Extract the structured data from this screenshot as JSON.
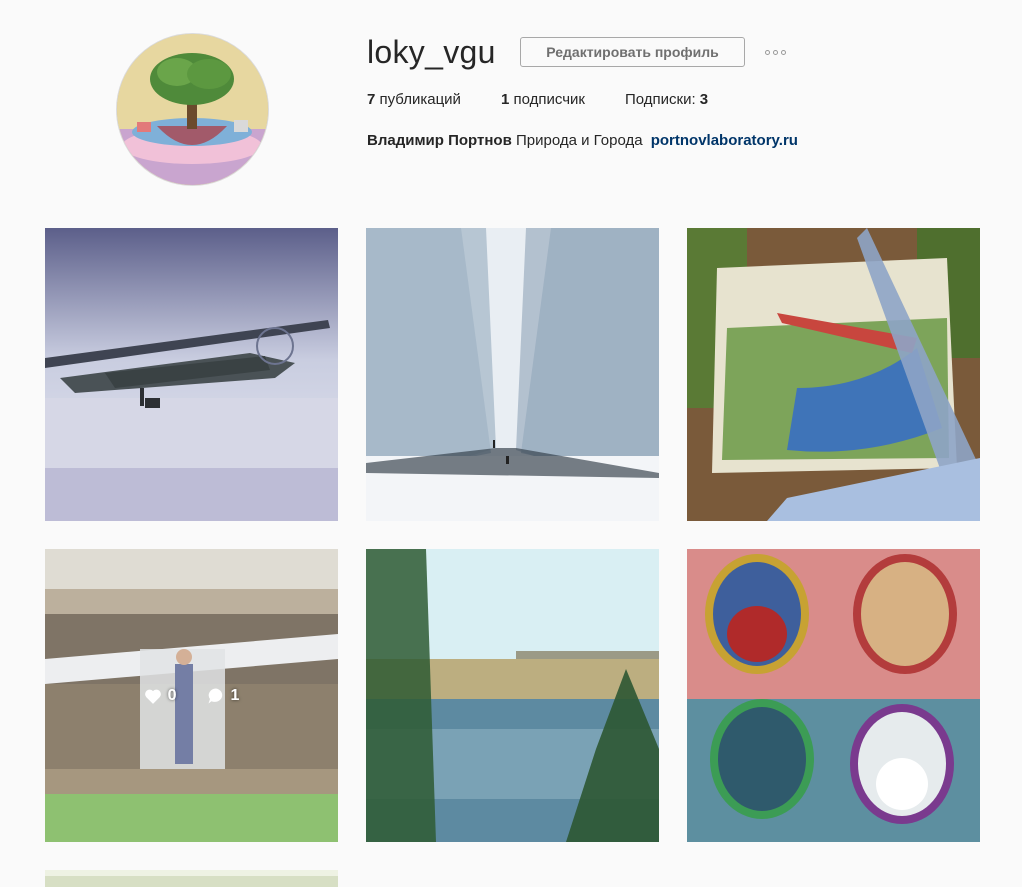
{
  "profile": {
    "username": "loky_vgu",
    "edit_button": "Редактировать профиль",
    "stats": {
      "posts_count": "7",
      "posts_label": "публикаций",
      "followers_count": "1",
      "followers_label": "подписчик",
      "following_label": "Подписки:",
      "following_count": "3"
    },
    "bio": {
      "name": "Владимир Портнов",
      "text": "Природа и Города",
      "link": "portnovlaboratory.ru"
    }
  },
  "posts": [
    {
      "subject": "biplane-in-snow"
    },
    {
      "subject": "snowy-tree-alley"
    },
    {
      "subject": "airplane-painting"
    },
    {
      "subject": "man-in-hangar",
      "hover": {
        "likes": "0",
        "comments": "1"
      }
    },
    {
      "subject": "lake-shore-view"
    },
    {
      "subject": "portrait-collage"
    },
    {
      "subject": "partial-post"
    }
  ],
  "colors": {
    "link": "#003569",
    "text": "#262626",
    "background": "#fafafa"
  },
  "icons": [
    "more-options-icon",
    "heart-icon",
    "comment-icon"
  ]
}
